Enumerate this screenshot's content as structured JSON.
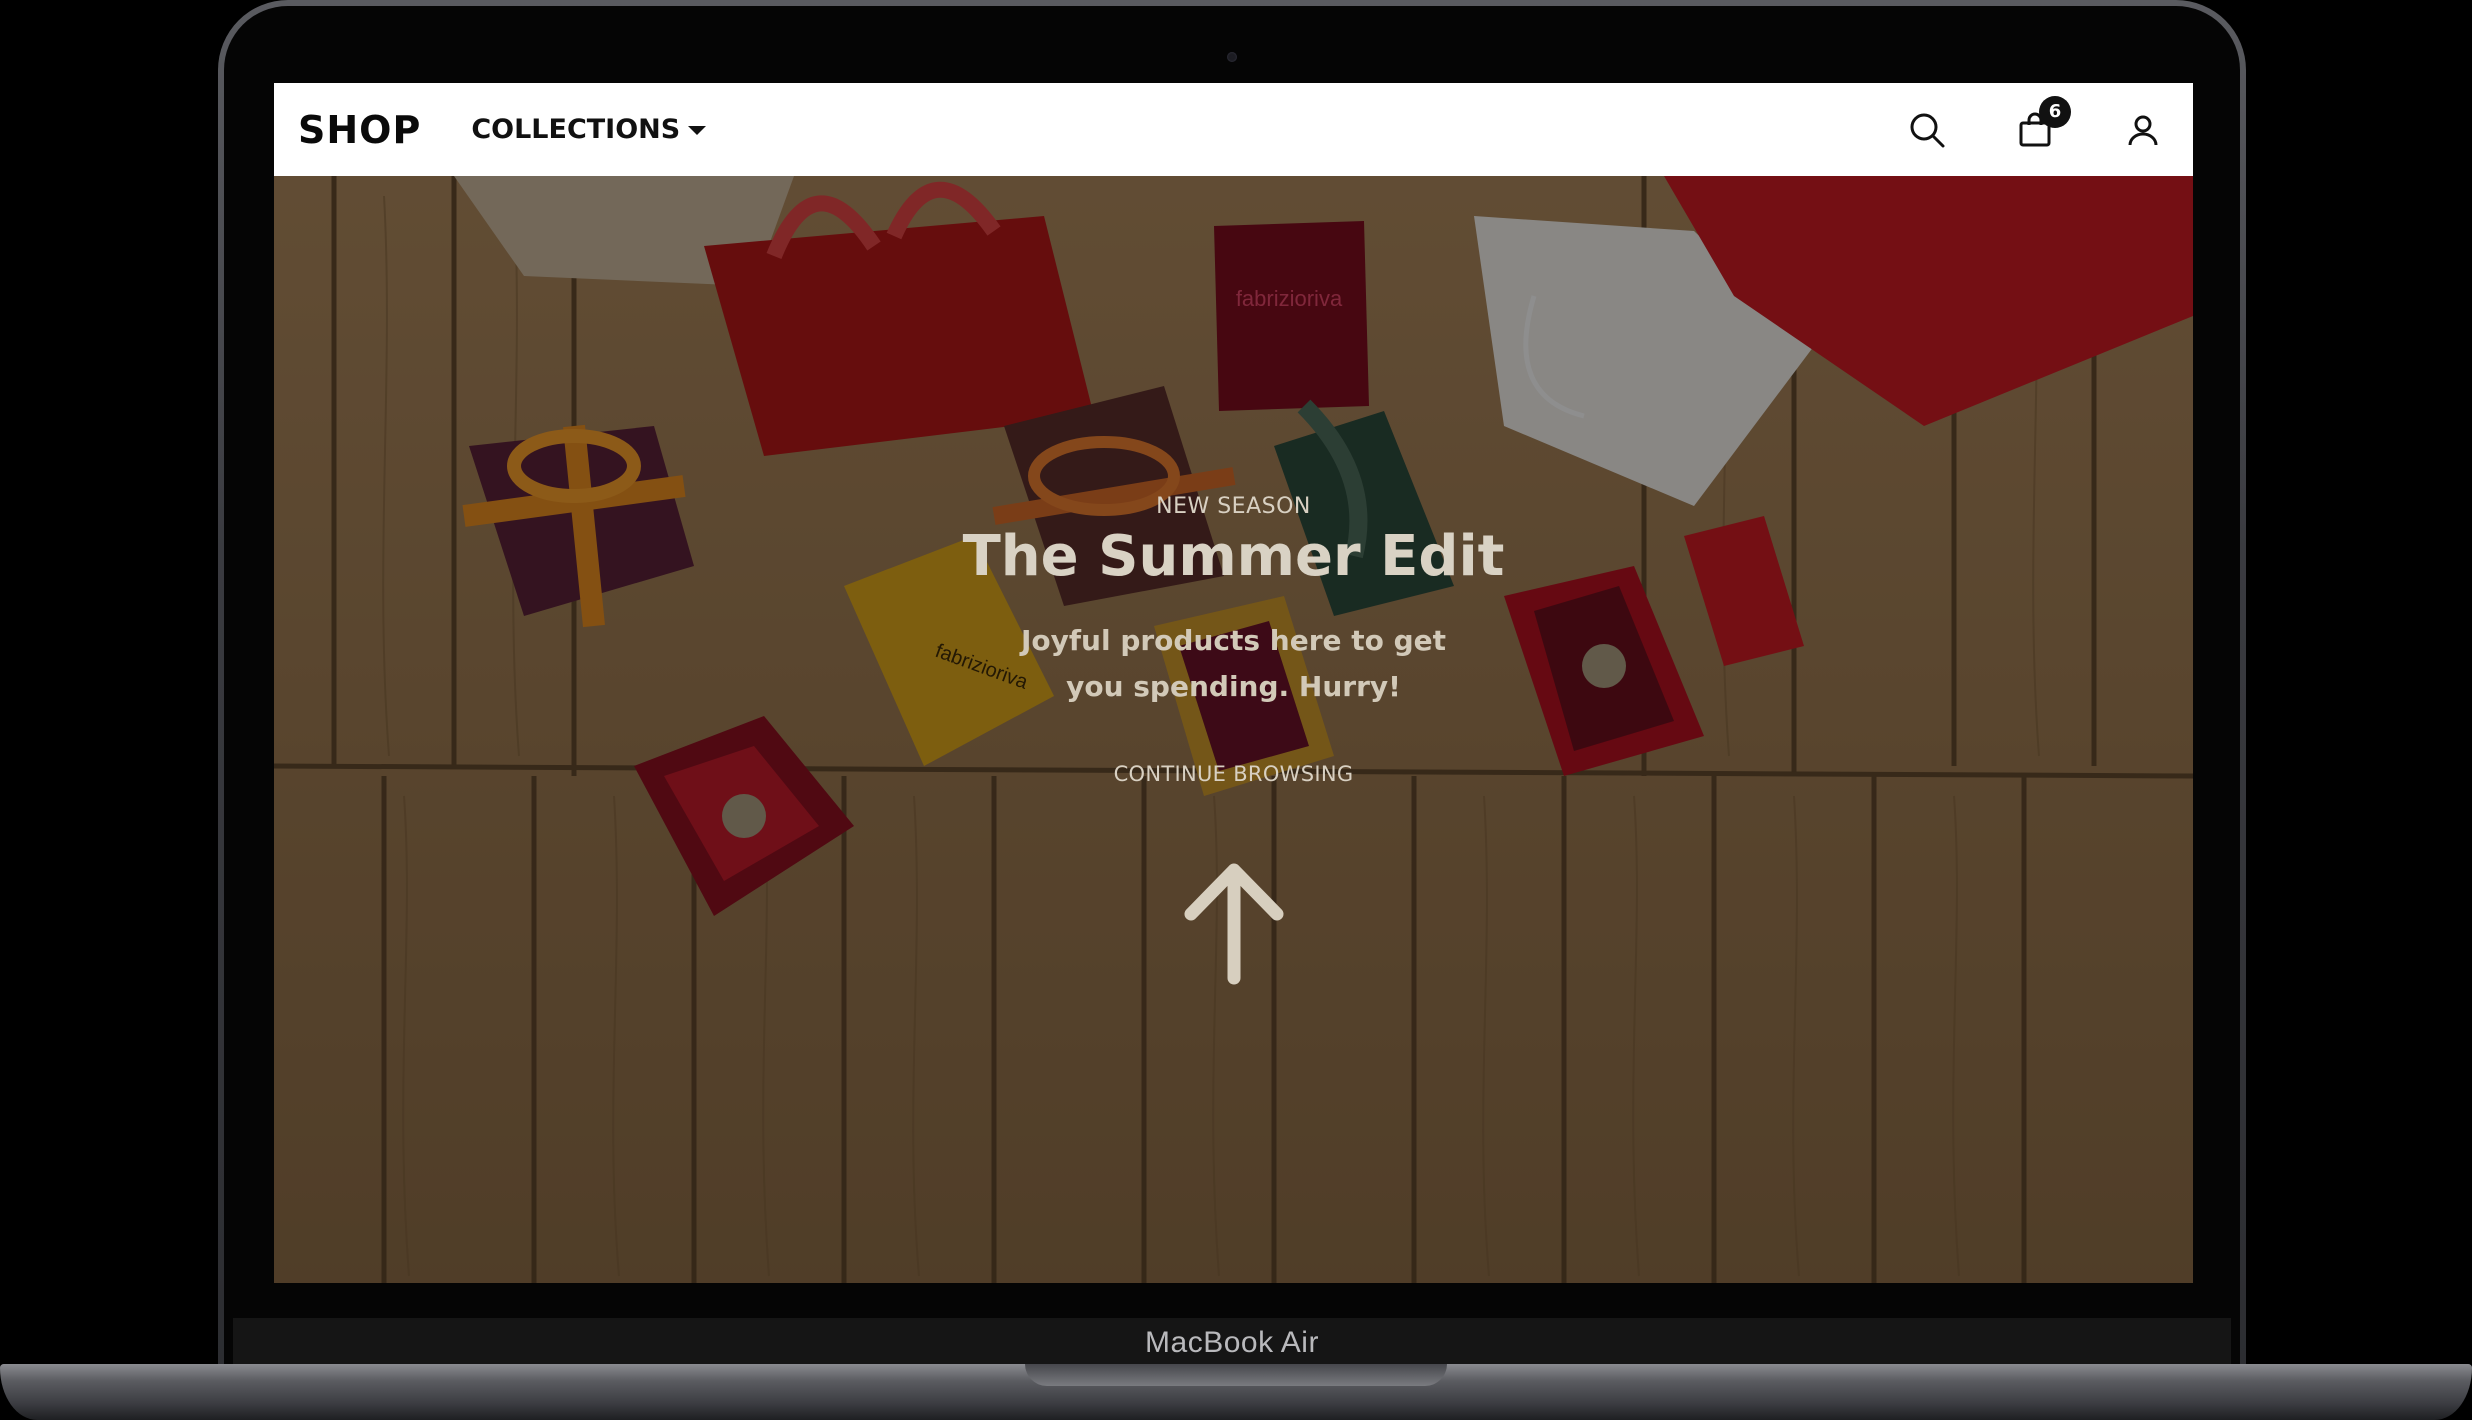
{
  "device": {
    "label": "MacBook Air"
  },
  "header": {
    "logo": "SHOP",
    "nav": {
      "collections_label": "COLLECTIONS"
    },
    "icons": {
      "search": "search-icon",
      "cart": "shopping-bag-icon",
      "account": "user-icon"
    },
    "cart_count": "6"
  },
  "hero": {
    "eyebrow": "NEW SEASON",
    "title": "The Summer Edit",
    "subtitle": "Joyful products here to get you spending. Hurry!",
    "link_label": "CONTINUE BROWSING",
    "arrow_icon": "arrow-up-icon",
    "background": "wooden floor with jewelry gift boxes and shopping bags"
  },
  "colors": {
    "header_bg": "#ffffff",
    "header_text": "#111111",
    "badge_bg": "#111111",
    "hero_text": "#d9d2c4"
  }
}
